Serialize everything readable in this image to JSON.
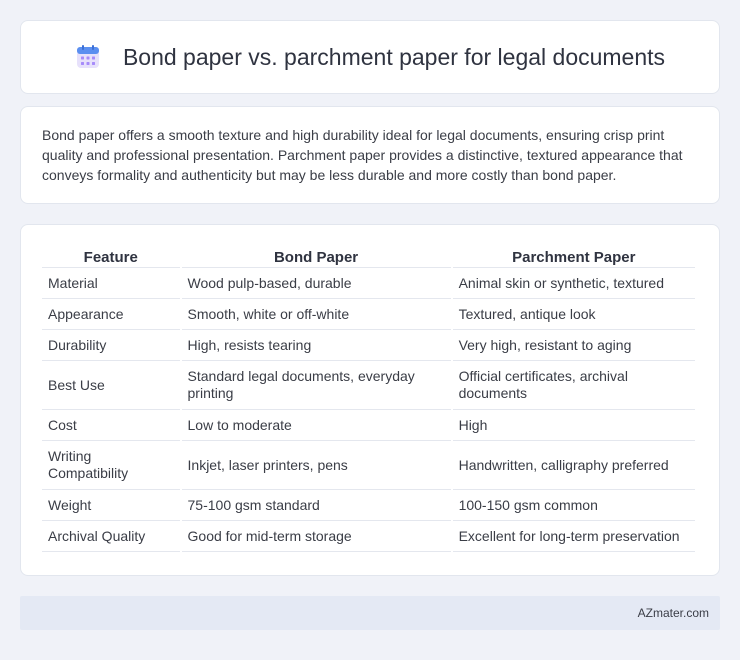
{
  "header": {
    "title": "Bond paper vs. parchment paper for legal documents",
    "icon": "calendar-icon"
  },
  "summary": {
    "text": "Bond paper offers a smooth texture and high durability ideal for legal documents, ensuring crisp print quality and professional presentation. Parchment paper provides a distinctive, textured appearance that conveys formality and authenticity but may be less durable and more costly than bond paper."
  },
  "table": {
    "headers": [
      "Feature",
      "Bond Paper",
      "Parchment Paper"
    ],
    "rows": [
      [
        "Material",
        "Wood pulp-based, durable",
        "Animal skin or synthetic, textured"
      ],
      [
        "Appearance",
        "Smooth, white or off-white",
        "Textured, antique look"
      ],
      [
        "Durability",
        "High, resists tearing",
        "Very high, resistant to aging"
      ],
      [
        "Best Use",
        "Standard legal documents, everyday printing",
        "Official certificates, archival documents"
      ],
      [
        "Cost",
        "Low to moderate",
        "High"
      ],
      [
        "Writing Compatibility",
        "Inkjet, laser printers, pens",
        "Handwritten, calligraphy preferred"
      ],
      [
        "Weight",
        "75-100 gsm standard",
        "100-150 gsm common"
      ],
      [
        "Archival Quality",
        "Good for mid-term storage",
        "Excellent for long-term preservation"
      ]
    ]
  },
  "footer": {
    "brand": "AZmater.com"
  },
  "colors": {
    "background": "#f0f2f8",
    "card": "#ffffff",
    "footer": "#e4e9f4",
    "icon_top": "#5b8ff0",
    "icon_grid": "#a78bfa"
  }
}
